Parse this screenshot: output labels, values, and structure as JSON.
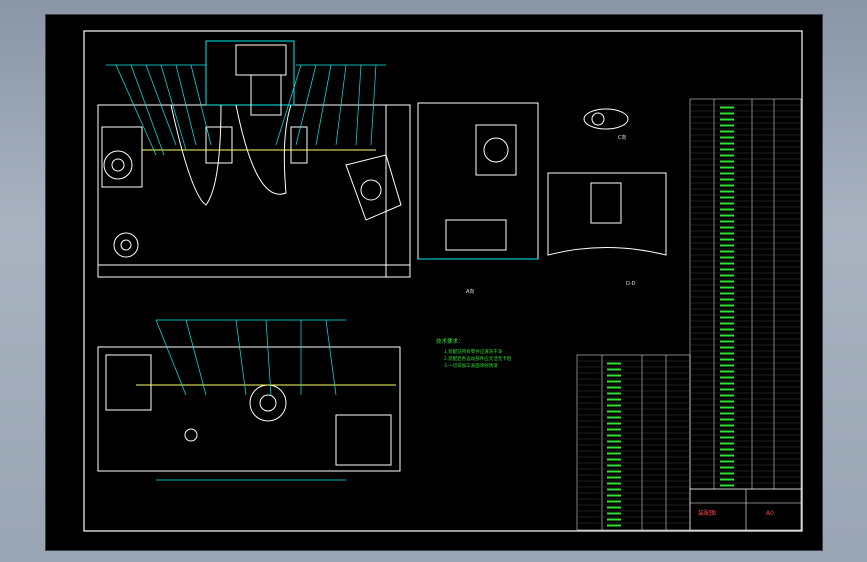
{
  "drawing": {
    "notes_heading": "技术要求：",
    "notes": [
      "1.装配前所有零件应清洗干净",
      "2.装配后各运动部件应灵活无卡阻",
      "3.一切非加工表面涂防锈漆"
    ],
    "view_labels": [
      "A向",
      "B向",
      "C向",
      "D-D"
    ],
    "title_block": {
      "name": "装配图",
      "sheet": "A0"
    },
    "colors": {
      "background": "#000000",
      "outline": "#ffffff",
      "leader": "#00e0e0",
      "text": "#30e030",
      "title": "#ff4040"
    }
  }
}
